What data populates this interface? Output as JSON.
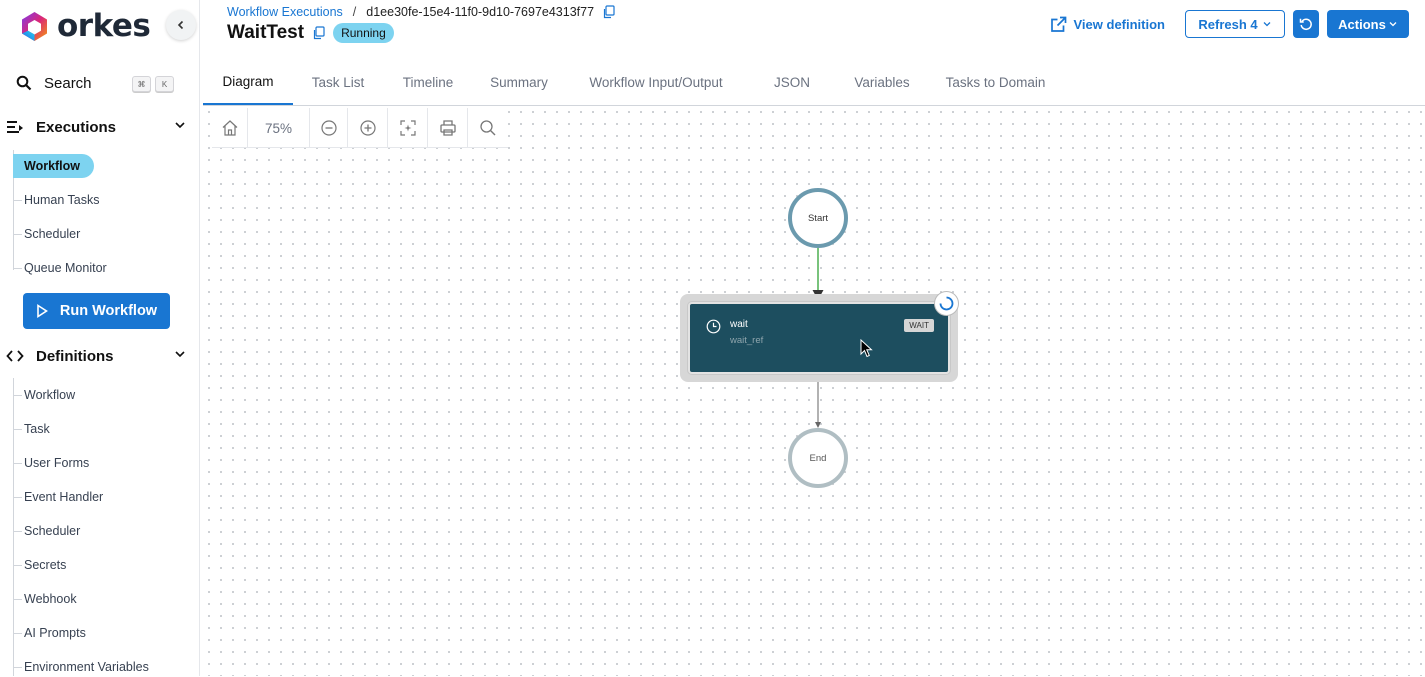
{
  "brand": {
    "name": "orkes"
  },
  "sidebar": {
    "search_label": "Search",
    "search_shortcut": [
      "⌘",
      "K"
    ],
    "executions": {
      "label": "Executions",
      "items": [
        {
          "label": "Workflow",
          "active": true
        },
        {
          "label": "Human Tasks"
        },
        {
          "label": "Scheduler"
        },
        {
          "label": "Queue Monitor"
        }
      ]
    },
    "run_workflow_label": "Run Workflow",
    "definitions": {
      "label": "Definitions",
      "items": [
        {
          "label": "Workflow"
        },
        {
          "label": "Task"
        },
        {
          "label": "User Forms"
        },
        {
          "label": "Event Handler"
        },
        {
          "label": "Scheduler"
        },
        {
          "label": "Secrets"
        },
        {
          "label": "Webhook"
        },
        {
          "label": "AI Prompts"
        },
        {
          "label": "Environment Variables"
        }
      ]
    }
  },
  "header": {
    "breadcrumb_link": "Workflow Executions",
    "breadcrumb_sep": "/",
    "execution_id": "d1ee30fe-15e4-11f0-9d10-7697e4313f77",
    "title": "WaitTest",
    "status": "Running",
    "view_definition": "View definition",
    "refresh": "Refresh 4",
    "actions": "Actions"
  },
  "tabs": [
    "Diagram",
    "Task List",
    "Timeline",
    "Summary",
    "Workflow Input/Output",
    "JSON",
    "Variables",
    "Tasks to Domain"
  ],
  "active_tab": "Diagram",
  "toolbar": {
    "zoom": "75%"
  },
  "diagram": {
    "start_label": "Start",
    "end_label": "End",
    "task": {
      "name": "wait",
      "ref": "wait_ref",
      "type": "WAIT"
    }
  },
  "colors": {
    "accent": "#1976d2",
    "status_running": "#7dd3f0",
    "task_bg": "#1d4e5f"
  }
}
